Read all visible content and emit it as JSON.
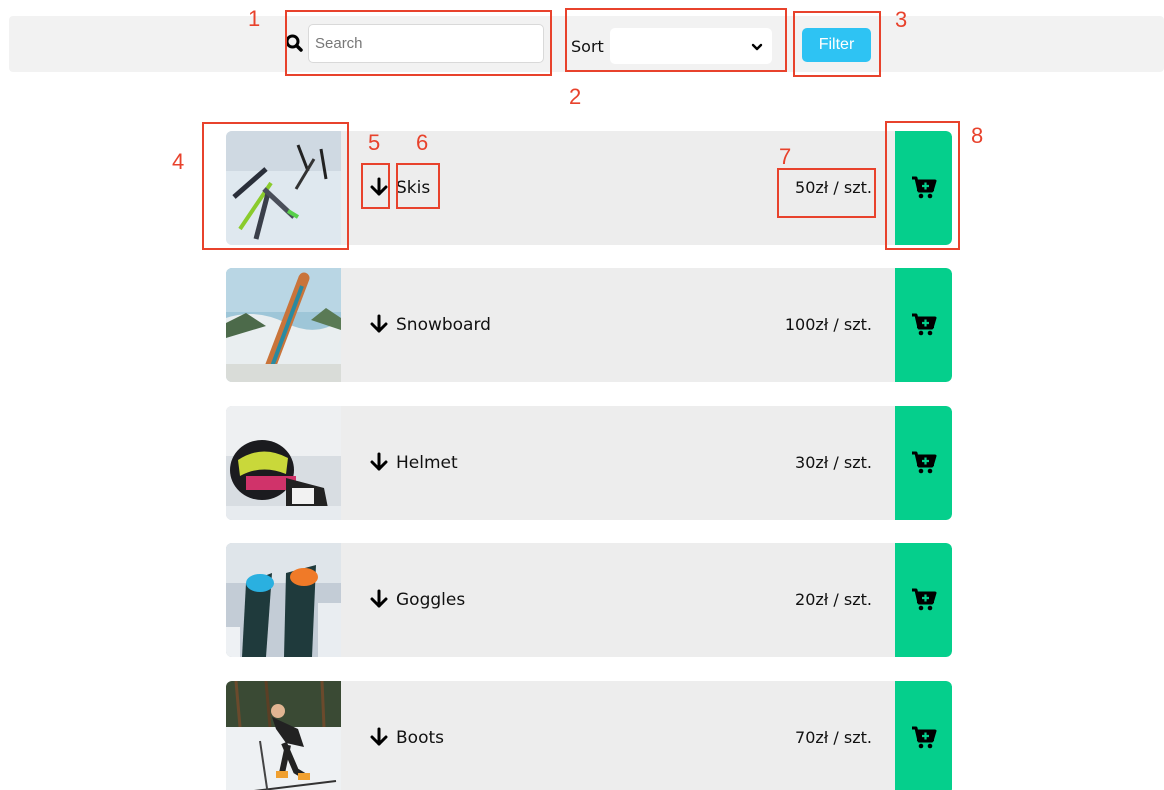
{
  "search": {
    "placeholder": "Search",
    "value": ""
  },
  "sort": {
    "label": "Sort",
    "selected": ""
  },
  "filter": {
    "label": "Filter"
  },
  "colors": {
    "accent": "#2ec3f3",
    "cart": "#05cf8c",
    "annotation": "#e8422c",
    "row_bg": "#ededed"
  },
  "annotations": [
    "1",
    "2",
    "3",
    "4",
    "5",
    "6",
    "7",
    "8"
  ],
  "products": [
    {
      "name": "Skis",
      "price": "50zł / szt.",
      "image_icon": "skis-photo"
    },
    {
      "name": "Snowboard",
      "price": "100zł / szt.",
      "image_icon": "snowboard-photo"
    },
    {
      "name": "Helmet",
      "price": "30zł / szt.",
      "image_icon": "helmet-photo"
    },
    {
      "name": "Goggles",
      "price": "20zł / szt.",
      "image_icon": "goggles-photo"
    },
    {
      "name": "Boots",
      "price": "70zł / szt.",
      "image_icon": "boots-photo"
    }
  ]
}
